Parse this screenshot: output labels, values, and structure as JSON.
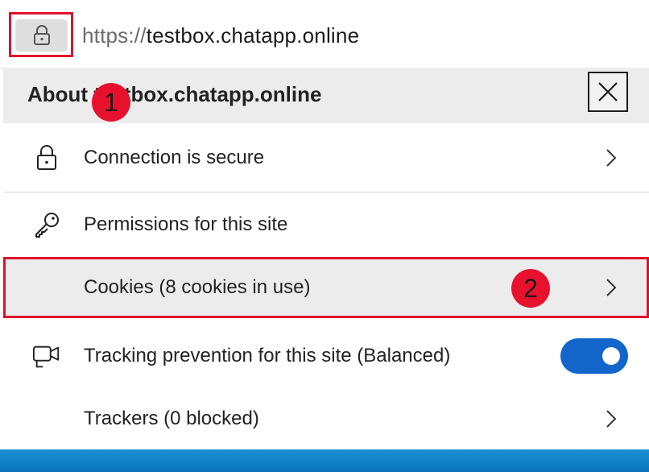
{
  "address_bar": {
    "url_scheme": "https://",
    "url_host": "testbox.chatapp.online"
  },
  "panel": {
    "title": "About testbox.chatapp.online",
    "close_icon": "close-icon"
  },
  "badges": [
    "1",
    "2"
  ],
  "rows": {
    "connection": {
      "label": "Connection is secure",
      "icon": "lock-icon"
    },
    "permissions": {
      "label": "Permissions for this site",
      "icon": "key-icon"
    },
    "cookies": {
      "label": "Cookies (8 cookies in use)"
    },
    "tracking": {
      "label": "Tracking prevention for this site (Balanced)",
      "icon": "tracking-camera-icon",
      "toggle_on": true
    },
    "trackers": {
      "label": "Trackers (0 blocked)"
    }
  },
  "colors": {
    "highlight": "#e0102e",
    "badge": "#e8112d",
    "toggle_on": "#1266c9",
    "header_bg": "#ececec"
  }
}
